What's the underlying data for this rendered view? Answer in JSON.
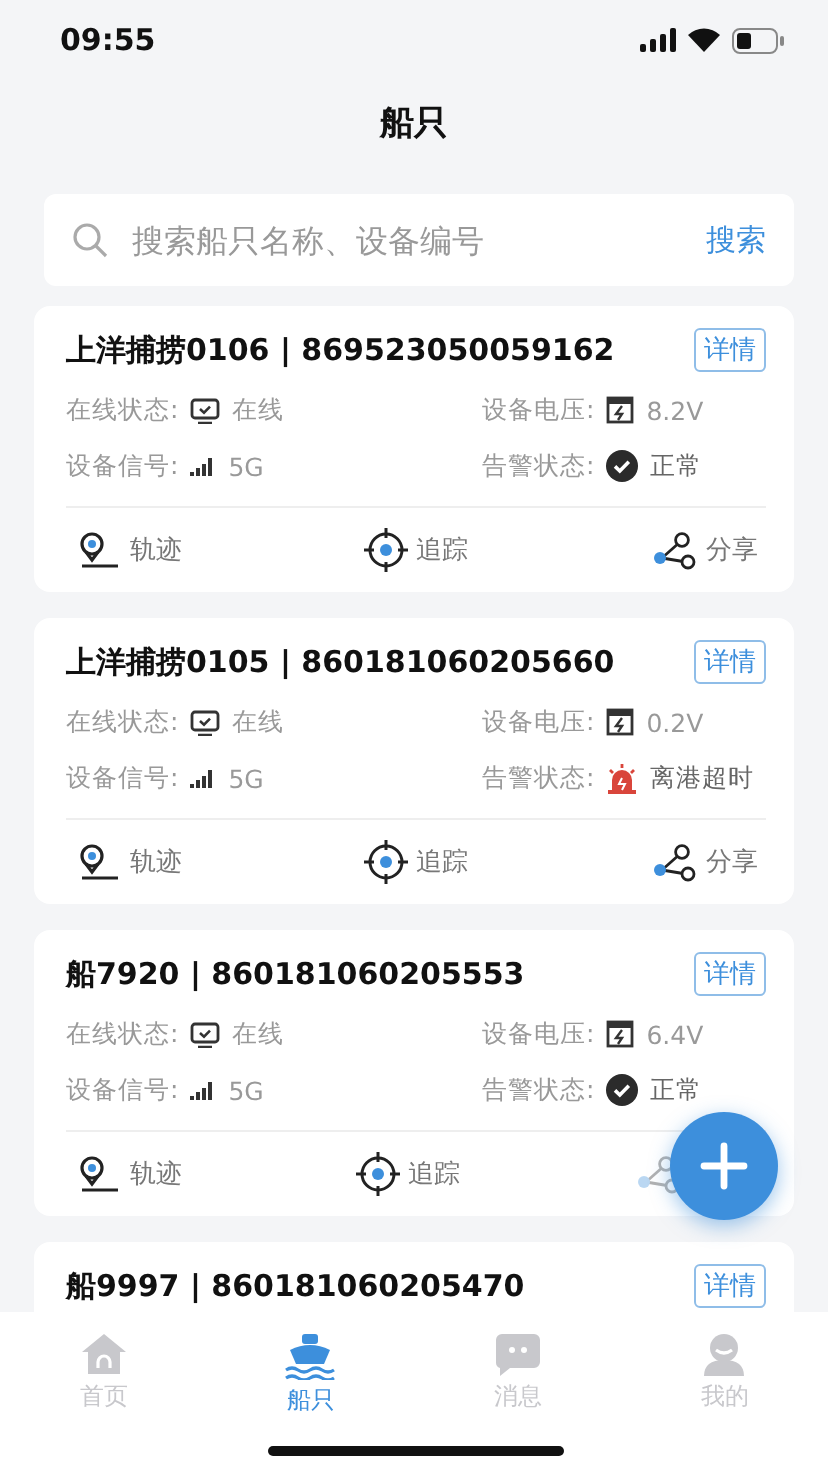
{
  "status_bar": {
    "time": "09:55"
  },
  "header": {
    "title": "船只"
  },
  "search": {
    "placeholder": "搜索船只名称、设备编号",
    "button": "搜索"
  },
  "ships": [
    {
      "title": "上洋捕捞0106 | 869523050059162",
      "detail": "详情",
      "online_label": "在线状态:",
      "online": "在线",
      "voltage_label": "设备电压:",
      "voltage": "8.2V",
      "signal_label": "设备信号:",
      "signal": "5G",
      "alarm_label": "告警状态:",
      "alarm": {
        "kind": "normal",
        "text": "正常"
      },
      "actions": [
        {
          "kind": "track",
          "label": "轨迹"
        },
        {
          "kind": "follow",
          "label": "追踪"
        },
        {
          "kind": "share",
          "label": "分享"
        }
      ]
    },
    {
      "title": "上洋捕捞0105 | 860181060205660",
      "detail": "详情",
      "online_label": "在线状态:",
      "online": "在线",
      "voltage_label": "设备电压:",
      "voltage": "0.2V",
      "signal_label": "设备信号:",
      "signal": "5G",
      "alarm_label": "告警状态:",
      "alarm": {
        "kind": "alert",
        "text": "离港超时"
      },
      "actions": [
        {
          "kind": "track",
          "label": "轨迹"
        },
        {
          "kind": "follow",
          "label": "追踪"
        },
        {
          "kind": "share",
          "label": "分享"
        }
      ]
    },
    {
      "title": "船7920 | 860181060205553",
      "detail": "详情",
      "online_label": "在线状态:",
      "online": "在线",
      "voltage_label": "设备电压:",
      "voltage": "6.4V",
      "signal_label": "设备信号:",
      "signal": "5G",
      "alarm_label": "告警状态:",
      "alarm": {
        "kind": "normal",
        "text": "正常"
      },
      "actions": [
        {
          "kind": "track",
          "label": "轨迹"
        },
        {
          "kind": "follow",
          "label": "追踪"
        },
        {
          "kind": "share"
        }
      ]
    },
    {
      "title": "船9997 | 860181060205470",
      "detail": "详情"
    }
  ],
  "tabs": [
    {
      "kind": "home",
      "label": "首页",
      "selected": false
    },
    {
      "kind": "ship",
      "label": "船只",
      "selected": true
    },
    {
      "kind": "message",
      "label": "消息",
      "selected": false
    },
    {
      "kind": "profile",
      "label": "我的",
      "selected": false
    }
  ]
}
